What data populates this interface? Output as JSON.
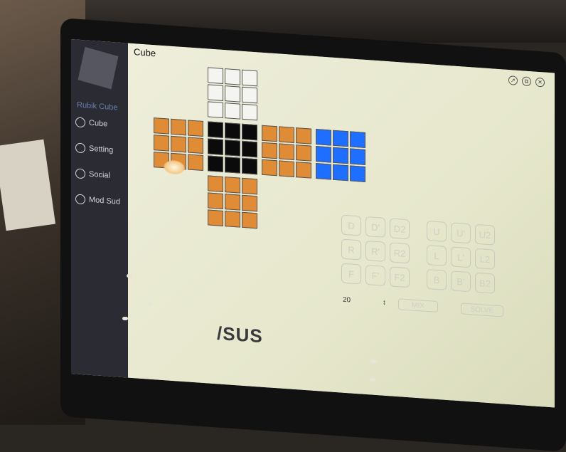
{
  "app": {
    "title": "Cube",
    "sidebar_name": "Rubik Cube"
  },
  "sidebar": {
    "items": [
      {
        "label": "Cube",
        "icon": "cube-icon"
      },
      {
        "label": "Setting",
        "icon": "gear-icon"
      },
      {
        "label": "Social",
        "icon": "social-icon"
      },
      {
        "label": "Mod Sud",
        "icon": "mod-icon"
      }
    ]
  },
  "window_controls": {
    "resize": "↗",
    "restore": "⧉",
    "close": "✕"
  },
  "cube": {
    "colors": {
      "white": "#f4f4f0",
      "black": "#0b0b0b",
      "orange": "#e08b35",
      "blue": "#1e6fff"
    },
    "faces": {
      "top": [
        "white",
        "white",
        "white",
        "white",
        "white",
        "white",
        "white",
        "white",
        "white"
      ],
      "left": [
        "orange",
        "orange",
        "orange",
        "orange",
        "orange",
        "orange",
        "orange",
        "orange",
        "orange"
      ],
      "front": [
        "black",
        "black",
        "black",
        "black",
        "black",
        "black",
        "black",
        "black",
        "black"
      ],
      "right": [
        "orange",
        "orange",
        "orange",
        "orange",
        "orange",
        "orange",
        "orange",
        "orange",
        "orange"
      ],
      "back": [
        "blue",
        "blue",
        "blue",
        "blue",
        "blue",
        "blue",
        "blue",
        "blue",
        "blue"
      ],
      "bottom": [
        "orange",
        "orange",
        "orange",
        "orange",
        "orange",
        "orange",
        "orange",
        "orange",
        "orange"
      ]
    }
  },
  "moves": {
    "group1": [
      "D",
      "D'",
      "D2",
      "R",
      "R'",
      "R2",
      "F",
      "F'",
      "F2"
    ],
    "group2": [
      "U",
      "U'",
      "U2",
      "L",
      "L'",
      "L2",
      "B",
      "B'",
      "B2"
    ]
  },
  "mix": {
    "count": "20",
    "stepper": "↕",
    "mix_label": "MIX",
    "solve_label": "SOLVE"
  },
  "brand": "/SUS"
}
